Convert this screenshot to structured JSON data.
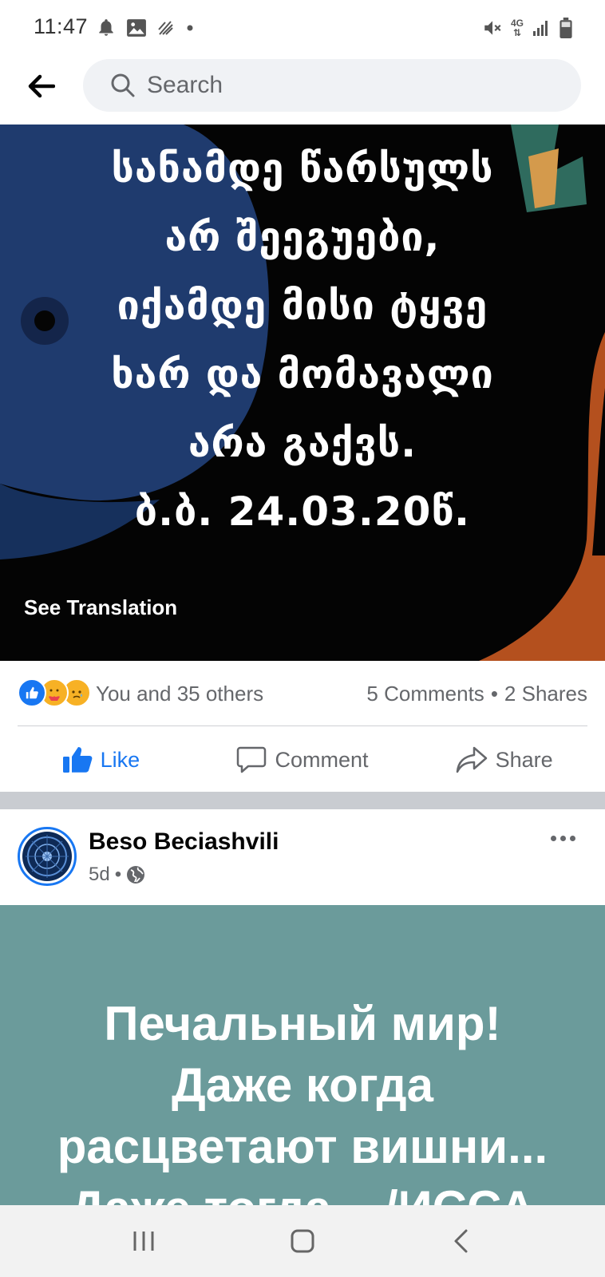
{
  "status_bar": {
    "time": "11:47",
    "network": "4G",
    "left_icons": [
      "bell-icon",
      "image-icon",
      "wifi-calling-icon",
      "dot-icon"
    ],
    "right_icons": [
      "mute-icon",
      "network-4g-icon",
      "signal-icon",
      "battery-icon"
    ]
  },
  "top_bar": {
    "search_placeholder": "Search"
  },
  "post1": {
    "quote": "სანამდე წარსულს\nარ შეეგუები,\nიქამდე მისი ტყვე\nხარ და მომავალი\nარა გაქვს.\nბ.ბ. 24.03.20წ.",
    "see_translation": "See Translation",
    "reactions_text": "You and 35 others",
    "comments": "5 Comments",
    "separator": "•",
    "shares": "2 Shares",
    "reactions": [
      "like",
      "care",
      "sad"
    ],
    "actions": {
      "like": "Like",
      "comment": "Comment",
      "share": "Share"
    }
  },
  "post2": {
    "author": "Beso Beciashvili",
    "time": "5d",
    "meta_separator": "•",
    "privacy_icon": "globe-icon",
    "text": "Печальный мир!\nДаже когда\nрасцветают вишни...\nДаже тогда... /ИССА"
  },
  "colors": {
    "accent": "#1877f2",
    "secondary_text": "#65676b",
    "post2_bg": "#6b9b9b"
  }
}
